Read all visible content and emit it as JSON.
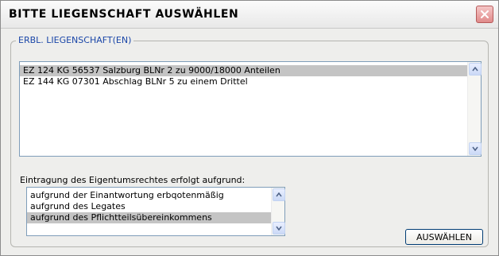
{
  "window": {
    "title": "BITTE LIEGENSCHAFT AUSWÄHLEN"
  },
  "group": {
    "label": "ERBL. LIEGENSCHAFT(EN)"
  },
  "properties_list": {
    "items": [
      {
        "label": "EZ 124 KG 56537 Salzburg BLNr 2  zu 9000/18000 Anteilen",
        "selected": true
      },
      {
        "label": "EZ 144 KG 07301 Abschlag BLNr 5  zu einem Drittel",
        "selected": false
      }
    ]
  },
  "basis_section": {
    "label": "Eintragung des Eigentumsrechtes erfolgt aufgrund:"
  },
  "basis_list": {
    "items": [
      {
        "label": "aufgrund der Einantwortung erbqotenmäßig",
        "selected": false
      },
      {
        "label": "aufgrund des Legates",
        "selected": false
      },
      {
        "label": "aufgrund des Pflichtteilsübereinkommens",
        "selected": true
      }
    ]
  },
  "actions": {
    "select_label": "AUSWÄHLEN"
  },
  "colors": {
    "group_label": "#1a46a8",
    "selection": "#c4c4c4",
    "list_border": "#7f9db9"
  },
  "icons": {
    "close": "close-icon",
    "scroll_up": "chevron-up-icon",
    "scroll_down": "chevron-down-icon"
  }
}
